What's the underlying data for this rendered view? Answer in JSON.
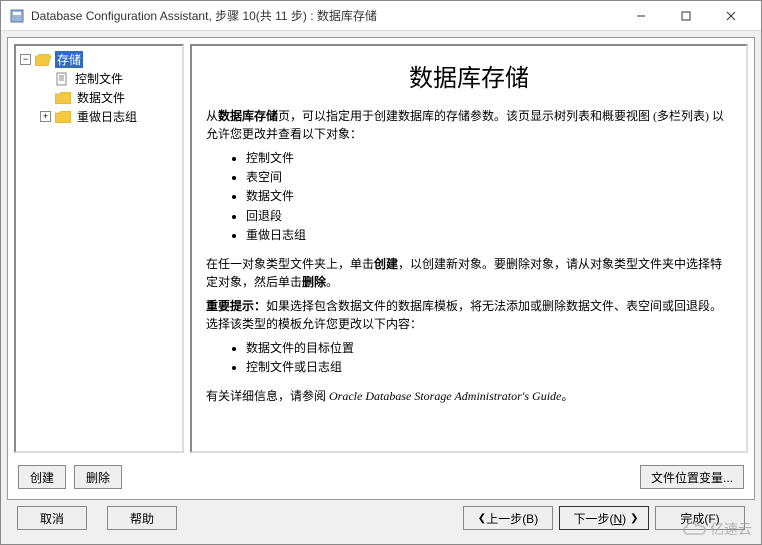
{
  "titlebar": {
    "title": "Database Configuration Assistant, 步骤 10(共 11 步) : 数据库存储"
  },
  "tree": {
    "root": "存储",
    "children": [
      {
        "label": "控制文件",
        "icon": "doc"
      },
      {
        "label": "数据文件",
        "icon": "folder"
      },
      {
        "label": "重做日志组",
        "icon": "folder",
        "expandable": true
      }
    ]
  },
  "page": {
    "title": "数据库存储",
    "intro_pre": "从",
    "intro_bold": "数据库存储",
    "intro_post": "页，可以指定用于创建数据库的存储参数。该页显示树列表和概要视图 (多栏列表) 以允许您更改并查看以下对象：",
    "list1": [
      "控制文件",
      "表空间",
      "数据文件",
      "回退段",
      "重做日志组"
    ],
    "para2_a": "在任一对象类型文件夹上，单击",
    "para2_b": "创建",
    "para2_c": "，以创建新对象。要删除对象，请从对象类型文件夹中选择特定对象，然后单击",
    "para2_d": "删除",
    "para2_e": "。",
    "para3_label": "重要提示：",
    "para3_text": "如果选择包含数据文件的数据库模板，将无法添加或删除数据文件、表空间或回退段。选择该类型的模板允许您更改以下内容：",
    "list2": [
      "数据文件的目标位置",
      "控制文件或日志组"
    ],
    "para4_a": "有关详细信息，请参阅 ",
    "para4_italic": "Oracle Database Storage Administrator's Guide",
    "para4_b": "。"
  },
  "middleButtons": {
    "create": "创建",
    "delete": "删除",
    "fileLoc": "文件位置变量..."
  },
  "bottom": {
    "cancel": "取消",
    "help": "帮助",
    "back": "上一步(B)",
    "next": "下一步(N)",
    "finish": "完成(F)"
  },
  "watermark": "亿速云"
}
